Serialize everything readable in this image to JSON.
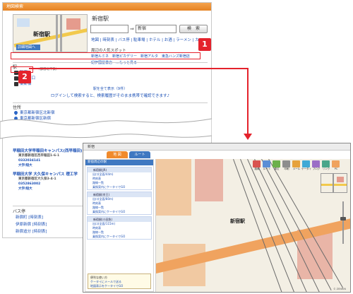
{
  "panel1": {
    "header": "地図検索",
    "map_label": "新宿駅",
    "map_bar_text": "詳細地図へ",
    "station_name": "新宿駅",
    "search_value": "新宿",
    "search_button": "検　索",
    "links": "地図 | 時刻表 | バス停 | 駐車場 | ホテル | お酒 | ラーメン | カフェ",
    "spots_title": "周辺の人気スポット",
    "spots_links": "新宿ルミネ　新宿ピカデリー　新宿アルタ　東急ハンズ新宿店",
    "spots_more": "紀伊國屋書店　…もっと見る",
    "station_section_head": "駅",
    "station_items": [
      "新宿",
      "新宿西口",
      "東新宿"
    ],
    "small_note": "（都営地下鉄）",
    "show_all": "駅を全て表示（9件）",
    "login_note": "ログインして検索すると、検索履歴がそのまま携帯で確認できます♪",
    "address_head": "住所",
    "address_items": [
      "東京都新宿区北新宿",
      "東京都新宿区新宿"
    ],
    "universities": [
      {
        "name": "早稲田大学早稲田キャンパス(西早稲田)",
        "addr": "東京都新宿区西早稲田1-6-1",
        "tel": "0332034141",
        "link": "大学/短大"
      },
      {
        "name": "早稲田大学 大久保キャンパス 理工学",
        "addr": "東京都新宿区大久保3-4-1",
        "tel": "0352863002",
        "link": "大学/短大"
      }
    ],
    "bus_head": "バス停",
    "bus_items": [
      "新宿町 [時刻表]",
      "伊原新宿 [時刻表]",
      "新宿追分 [時刻表]"
    ]
  },
  "badges": {
    "one": "1",
    "two": "2"
  },
  "panel2": {
    "top_title": "新宿",
    "tab_map": "地 図",
    "tab_route": "ルート",
    "side_head": "新宿周辺の駅",
    "groups": [
      {
        "title": "新宿駅(JR)",
        "lines": [
          "出口(全面/44m)",
          "時刻表",
          "路線一覧",
          "乗換案内にケータイでGO"
        ]
      },
      {
        "title": "新宿駅(京王)",
        "lines": [
          "出口(全面/80m)",
          "時刻表",
          "路線一覧",
          "乗換案内にケータイでGO"
        ]
      },
      {
        "title": "新宿駅(小田急)",
        "lines": [
          "出口(全面/115m)",
          "時刻表",
          "路線一覧",
          "乗換案内にケータイでGO"
        ]
      }
    ],
    "note_title": "便利な使い方",
    "note_lines": [
      "ケータイにメールで送る",
      "地図表示をケータイでGO"
    ],
    "map_label": "新宿駅",
    "toolbar": [
      "路線",
      "ルート",
      "周辺",
      "印刷",
      "メール",
      "ケータイ",
      "ブログ",
      "リンク",
      "PC"
    ],
    "copyright": "© ZENRIN"
  },
  "colors": {
    "accent_red": "#e4222c",
    "header_orange": "#e58222",
    "link_blue": "#1a4fb5"
  }
}
